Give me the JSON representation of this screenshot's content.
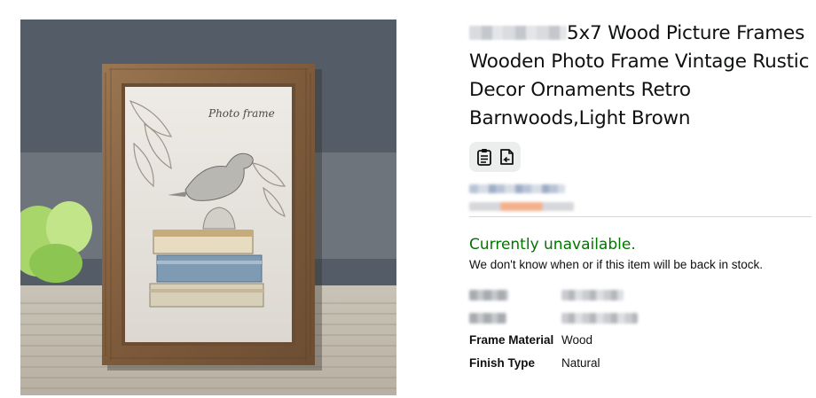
{
  "product": {
    "title_rest": "5x7 Wood Picture Frames Wooden Photo Frame Vintage Rustic Decor Ornaments Retro Barnwoods,Light Brown",
    "image_alt": "Wooden photo frame with bird on books artwork",
    "frame_insert_text": "Photo frame"
  },
  "icons": {
    "share": "clipboard-icon",
    "return": "return-doc-icon"
  },
  "availability": {
    "status": "Currently unavailable.",
    "note": "We don't know when or if this item will be back in stock."
  },
  "specs": [
    {
      "label": "Frame Material",
      "value": "Wood"
    },
    {
      "label": "Finish Type",
      "value": "Natural"
    }
  ],
  "colors": {
    "availability_green": "#007600",
    "text": "#0f1111",
    "divider": "#d5d9d9",
    "pill_bg": "#eceeee"
  }
}
